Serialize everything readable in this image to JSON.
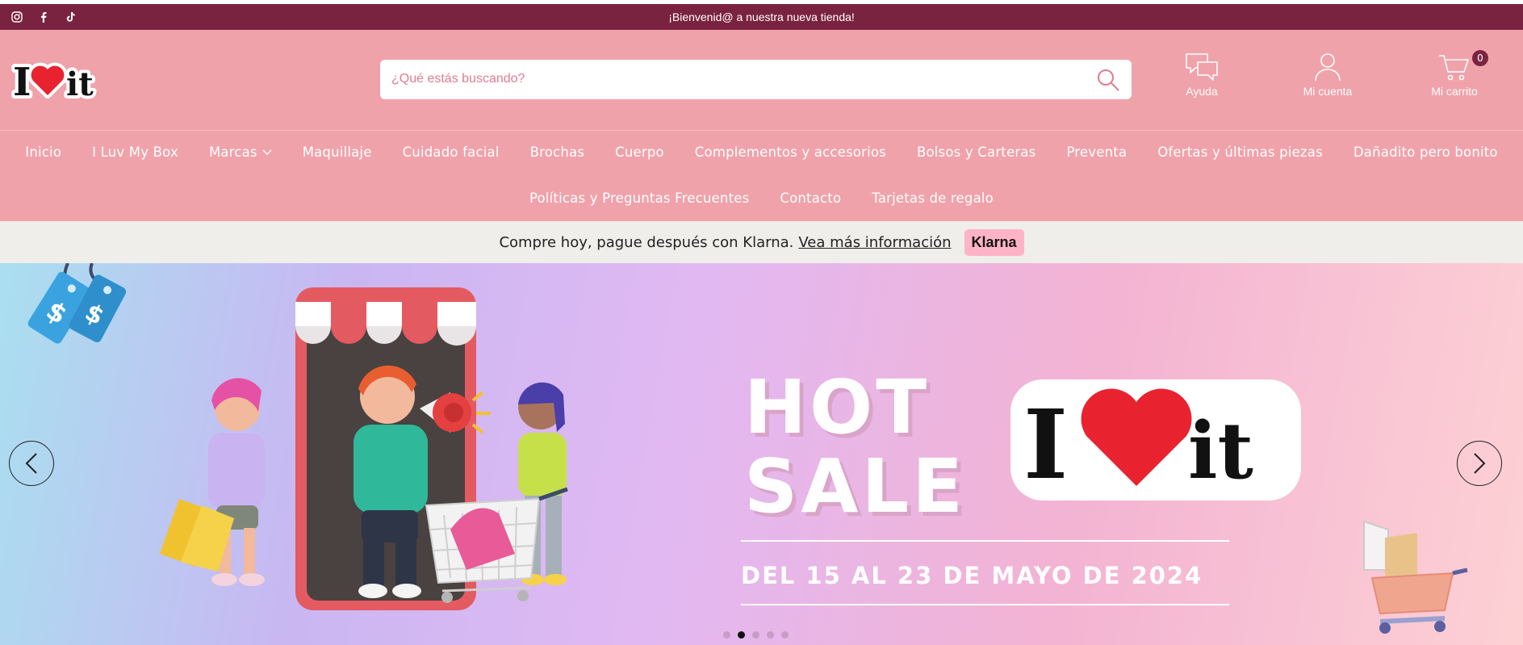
{
  "topbar": {
    "welcome": "¡Bienvenid@ a nuestra nueva tienda!",
    "social_icons": [
      "instagram-icon",
      "facebook-icon",
      "tiktok-icon"
    ]
  },
  "header": {
    "logo_text": "I it",
    "search": {
      "placeholder": "¿Qué estás buscando?"
    },
    "actions": {
      "help": "Ayuda",
      "account": "Mi cuenta",
      "cart": "Mi carrito",
      "cart_count": "0"
    }
  },
  "nav": {
    "row1": [
      "Inicio",
      "I Luv My Box",
      "Marcas",
      "Maquillaje",
      "Cuidado facial",
      "Brochas",
      "Cuerpo",
      "Complementos y accesorios",
      "Bolsos y Carteras",
      "Preventa",
      "Ofertas y últimas piezas",
      "Dañadito pero bonito"
    ],
    "row2": [
      "Políticas y Preguntas Frecuentes",
      "Contacto",
      "Tarjetas de regalo"
    ]
  },
  "klarna": {
    "text": "Compre hoy, pague después con Klarna.",
    "link": "Veа más información",
    "badge": "Klarna"
  },
  "hero": {
    "line1": "HOT",
    "line2": "SALE",
    "dates": "DEL 15 AL 23 DE MAYO DE 2024",
    "slides": 5,
    "active_slide": 2
  },
  "colors": {
    "topbar": "#7a2340",
    "header": "#f0a2ab",
    "klarna_bar": "#efeeea",
    "klarna_badge": "#ffb3c7",
    "heart": "#e8232f"
  }
}
